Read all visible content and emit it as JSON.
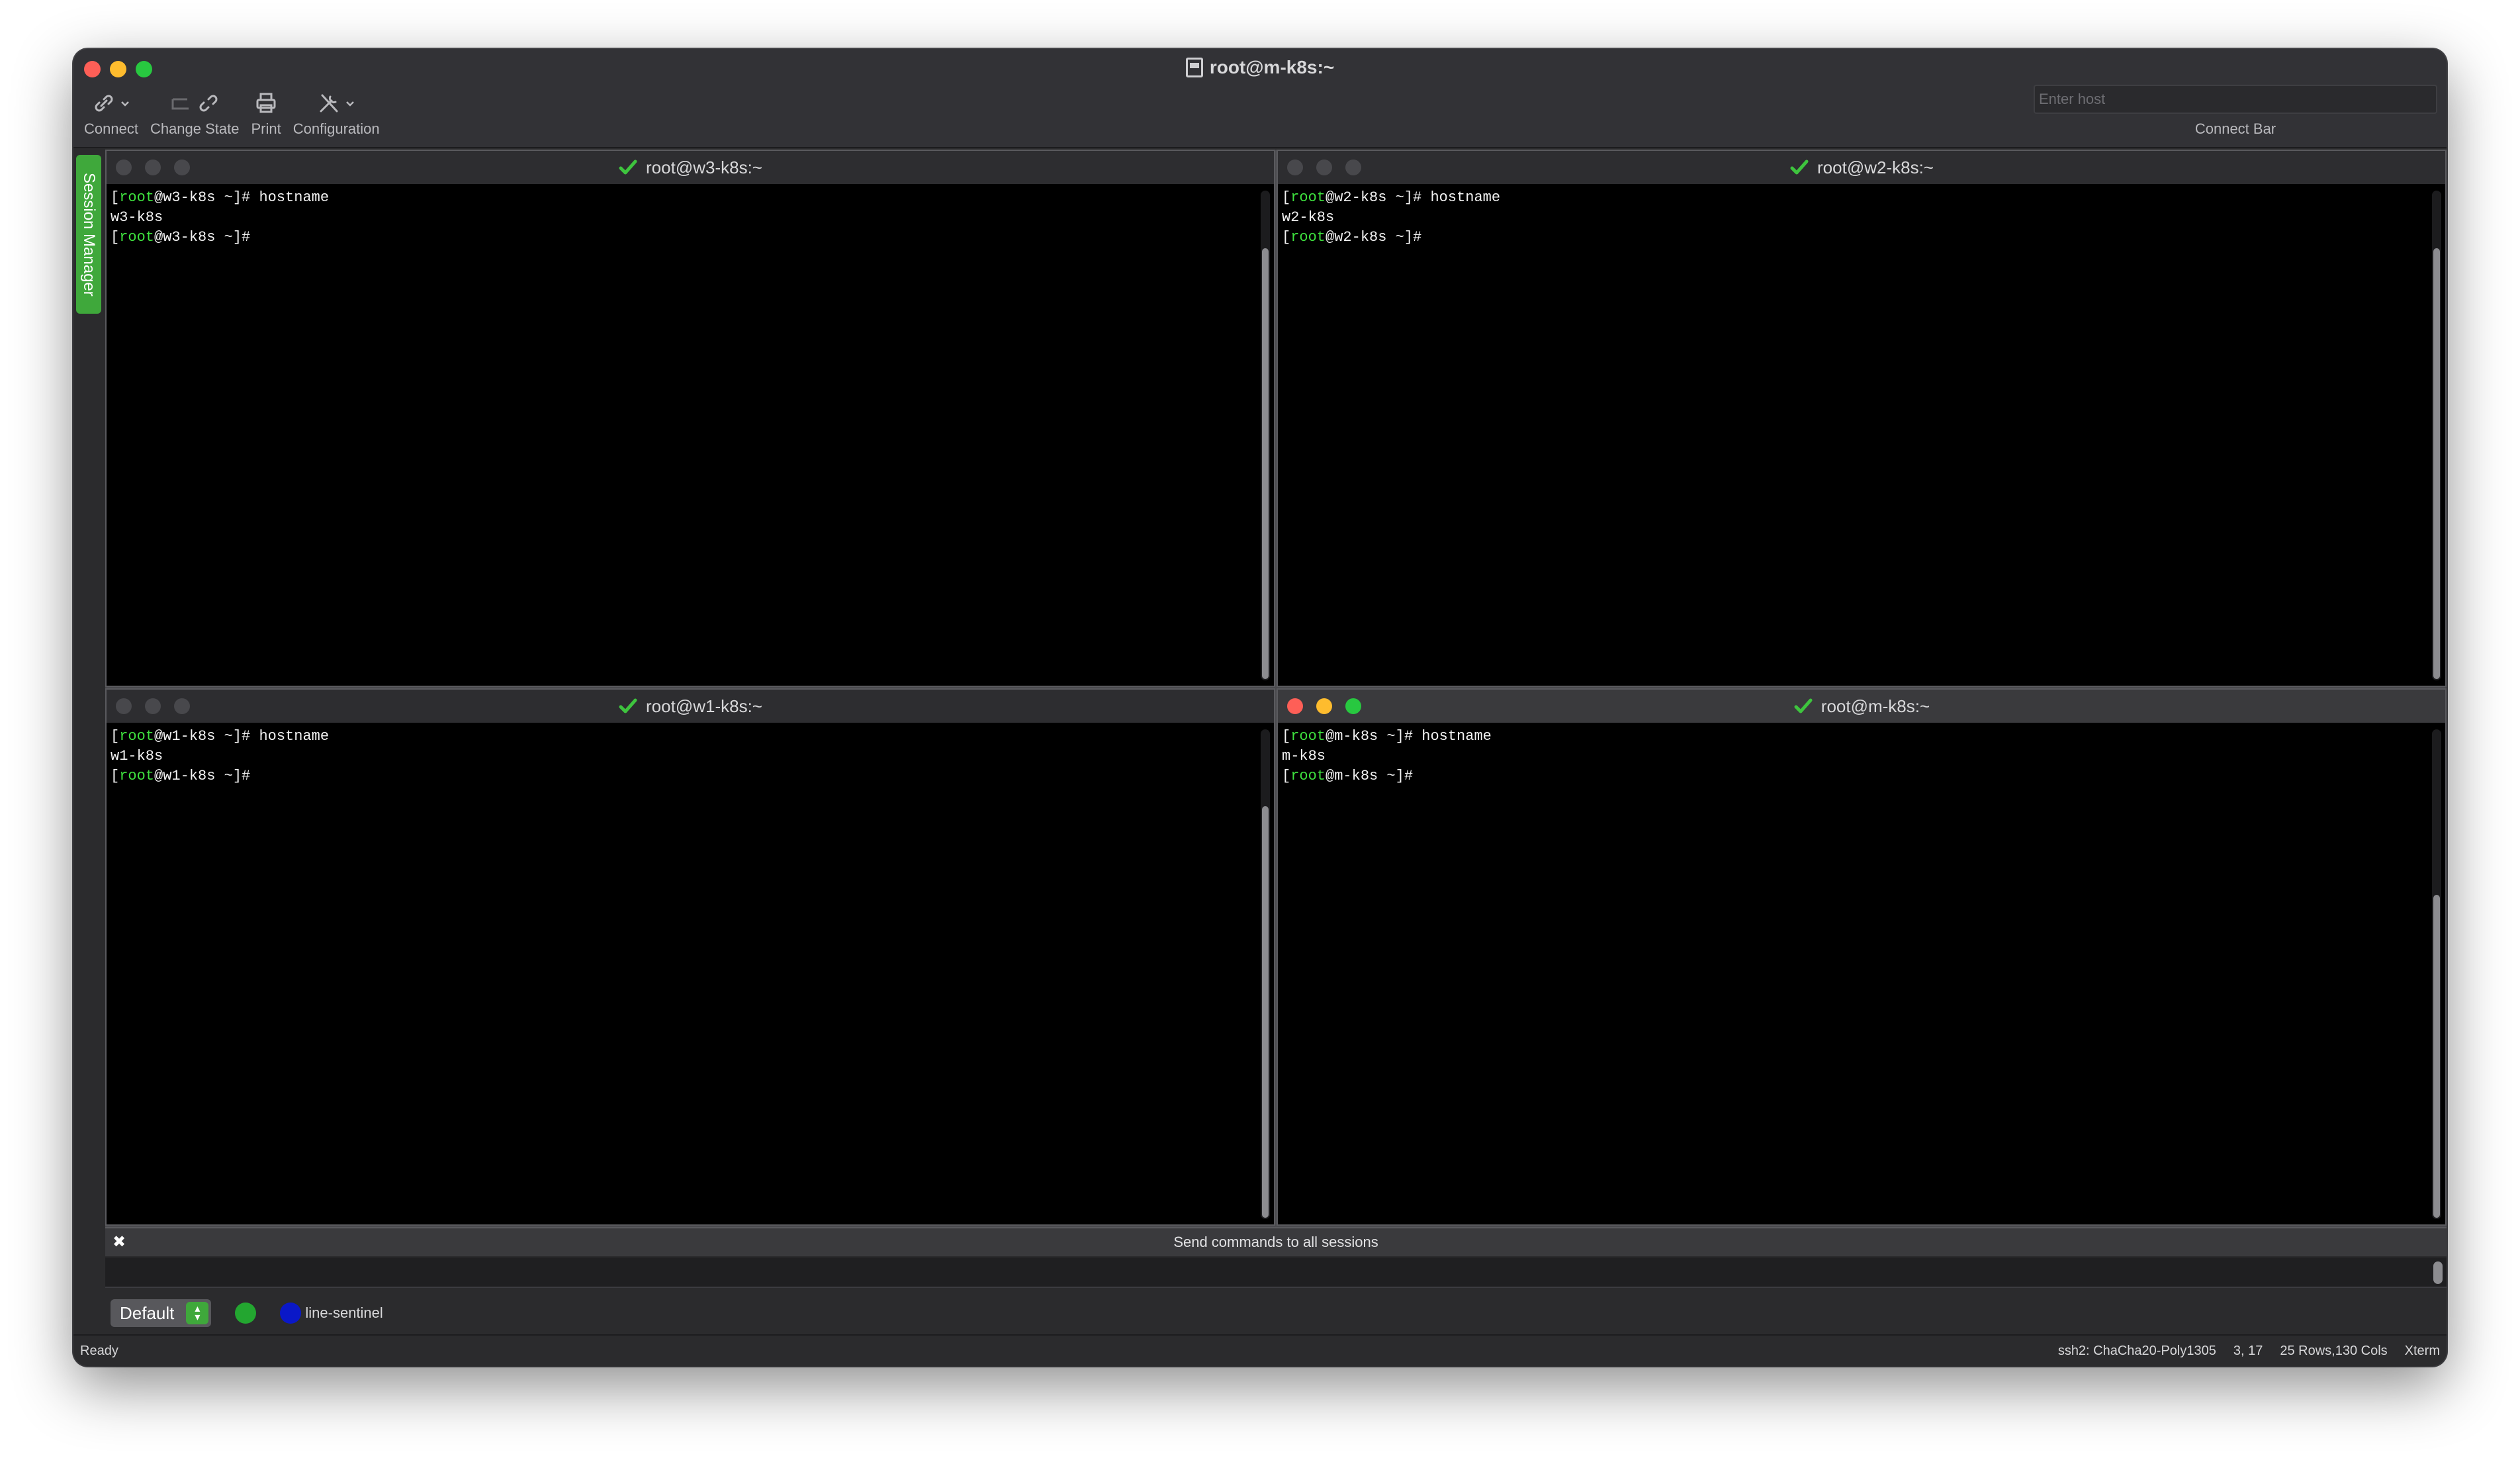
{
  "window": {
    "title": "root@m-k8s:~"
  },
  "toolbar": {
    "connect_label": "Connect",
    "change_state_label": "Change State",
    "print_label": "Print",
    "configuration_label": "Configuration"
  },
  "connect_bar": {
    "placeholder": "Enter host",
    "label": "Connect Bar"
  },
  "session_manager": {
    "label": "Session Manager"
  },
  "sessions": [
    {
      "title": "root@w3-k8s:~",
      "active": false,
      "lines": [
        {
          "pre": "[",
          "user": "root",
          "post": "@w3-k8s ~]# hostname"
        },
        {
          "pre": "w3-k8s",
          "user": "",
          "post": ""
        },
        {
          "pre": "[",
          "user": "root",
          "post": "@w3-k8s ~]#"
        }
      ],
      "scroll_fraction": 0.88
    },
    {
      "title": "root@w2-k8s:~",
      "active": false,
      "lines": [
        {
          "pre": "[",
          "user": "root",
          "post": "@w2-k8s ~]# hostname"
        },
        {
          "pre": "w2-k8s",
          "user": "",
          "post": ""
        },
        {
          "pre": "[",
          "user": "root",
          "post": "@w2-k8s ~]#"
        }
      ],
      "scroll_fraction": 0.88
    },
    {
      "title": "root@w1-k8s:~",
      "active": false,
      "lines": [
        {
          "pre": "[",
          "user": "root",
          "post": "@w1-k8s ~]# hostname"
        },
        {
          "pre": "w1-k8s",
          "user": "",
          "post": ""
        },
        {
          "pre": "[",
          "user": "root",
          "post": "@w1-k8s ~]#"
        }
      ],
      "scroll_fraction": 0.84
    },
    {
      "title": "root@m-k8s:~",
      "active": true,
      "lines": [
        {
          "pre": "[",
          "user": "root",
          "post": "@m-k8s ~]# hostname"
        },
        {
          "pre": "m-k8s",
          "user": "",
          "post": ""
        },
        {
          "pre": "[",
          "user": "root",
          "post": "@m-k8s ~]#"
        }
      ],
      "scroll_fraction": 0.66
    }
  ],
  "send_bar": {
    "title": "Send commands to all sessions",
    "close_glyph": "✖"
  },
  "button_bar": {
    "preset": "Default",
    "sentinel_label": "line-sentinel"
  },
  "status_bar": {
    "status": "Ready",
    "cipher": "ssh2: ChaCha20-Poly1305",
    "cursor": "3, 17",
    "size": "25 Rows,130 Cols",
    "emulation": "Xterm"
  },
  "colors": {
    "accent_green": "#3fa83b",
    "prompt_user": "#3ee03e",
    "terminal_bg": "#000000",
    "sentinel_blue": "#0a18c8"
  },
  "icons": [
    "connect-icon",
    "change-state-icon",
    "print-icon",
    "configuration-icon",
    "checkmark-icon",
    "close-icon"
  ]
}
